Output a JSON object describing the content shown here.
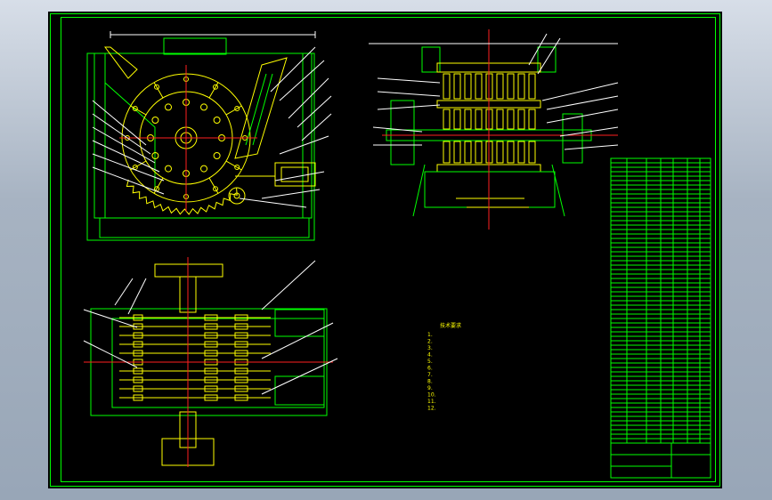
{
  "drawing": {
    "notes_title": "技术要求",
    "notes": [
      "1.  ",
      "2.  ",
      "3.  ",
      "4.  ",
      "5.  ",
      "6.  ",
      "7.  ",
      "8.  ",
      "9.  ",
      "10.  ",
      "11.  ",
      "12.  "
    ],
    "colors": {
      "background": "#000000",
      "outline": "#00ff00",
      "parts": "#ffff00",
      "leaders": "#ffffff",
      "centerlines": "#ff2020"
    }
  }
}
